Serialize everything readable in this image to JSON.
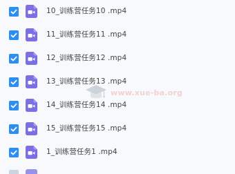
{
  "files": [
    {
      "name": "10_训练营任务10 .mp4",
      "checked": true
    },
    {
      "name": "11_训练营任务11 .mp4",
      "checked": true
    },
    {
      "name": "12_训练营任务12 .mp4",
      "checked": true
    },
    {
      "name": "13_训练营任务13 .mp4",
      "checked": true
    },
    {
      "name": "14_训练营任务14 .mp4",
      "checked": true
    },
    {
      "name": "15_训练营任务15 .mp4",
      "checked": true
    },
    {
      "name": "1_训练营任务1 .mp4",
      "checked": true
    }
  ],
  "watermark": {
    "text": "www.xue-ba.org"
  },
  "colors": {
    "checkbox": "#2b8ef3",
    "video_icon": "#7b6fe4",
    "filename_text": "#434343",
    "background": "#f7f9fc"
  },
  "icons": {
    "checkbox": "checkmark-icon",
    "file": "video-file-icon",
    "watermark": "graduation-cap-logo"
  }
}
